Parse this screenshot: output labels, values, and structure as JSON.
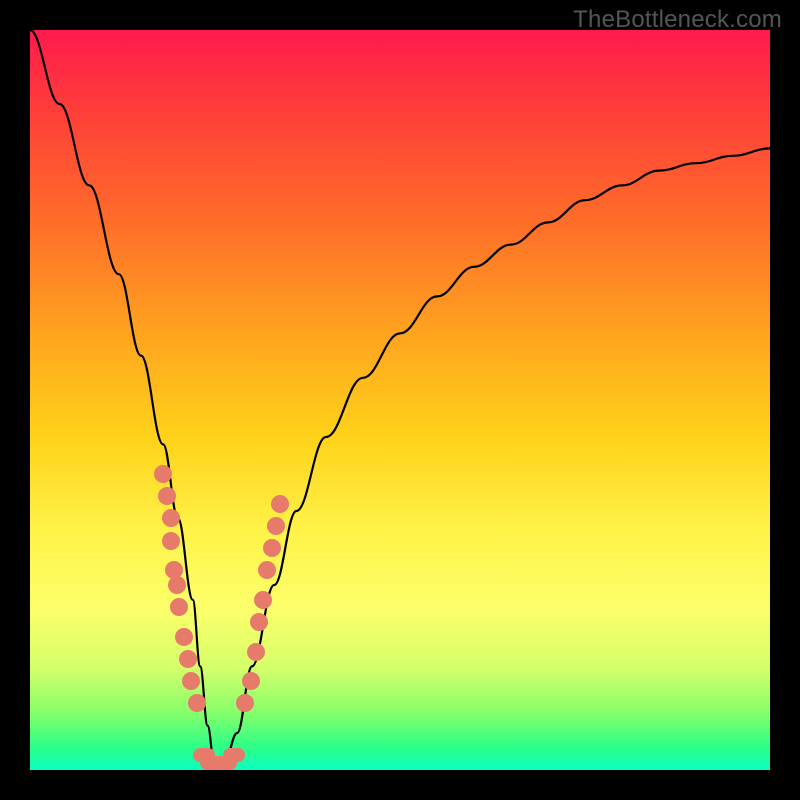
{
  "watermark": "TheBottleneck.com",
  "colors": {
    "frame": "#000000",
    "dot": "#e77b6b",
    "curve": "#000000",
    "gradient_top": "#ff1a4d",
    "gradient_bottom": "#0affc2"
  },
  "chart_data": {
    "type": "line",
    "title": "",
    "xlabel": "",
    "ylabel": "",
    "xlim": [
      0,
      100
    ],
    "ylim": [
      0,
      100
    ],
    "grid": false,
    "legend": false,
    "series": [
      {
        "name": "bottleneck-curve",
        "x": [
          0,
          4,
          8,
          12,
          15,
          18,
          20,
          22,
          23,
          24,
          25,
          26,
          28,
          30,
          33,
          36,
          40,
          45,
          50,
          55,
          60,
          65,
          70,
          75,
          80,
          85,
          90,
          95,
          100
        ],
        "y": [
          100,
          90,
          79,
          67,
          56,
          44,
          34,
          23,
          14,
          6,
          0,
          0,
          5,
          14,
          25,
          35,
          45,
          53,
          59,
          64,
          68,
          71,
          74,
          77,
          79,
          81,
          82,
          83,
          84
        ]
      }
    ],
    "points": [
      {
        "name": "left-cluster",
        "xy": [
          [
            18,
            40
          ],
          [
            18.5,
            37
          ],
          [
            19,
            34
          ],
          [
            19,
            31
          ],
          [
            19.5,
            27
          ],
          [
            19.8,
            25
          ],
          [
            20.2,
            22
          ],
          [
            20.8,
            18
          ],
          [
            21.3,
            15
          ],
          [
            21.8,
            12
          ],
          [
            22.5,
            9
          ]
        ]
      },
      {
        "name": "valley-cluster",
        "xy": [
          [
            23.5,
            2
          ],
          [
            24.5,
            1
          ],
          [
            25.5,
            1
          ],
          [
            26.5,
            1
          ],
          [
            27.5,
            2
          ]
        ]
      },
      {
        "name": "right-cluster",
        "xy": [
          [
            29,
            9
          ],
          [
            29.8,
            12
          ],
          [
            30.5,
            16
          ],
          [
            31,
            20
          ],
          [
            31.5,
            23
          ],
          [
            32,
            27
          ],
          [
            32.7,
            30
          ],
          [
            33.2,
            33
          ],
          [
            33.8,
            36
          ]
        ]
      }
    ],
    "annotations": []
  }
}
